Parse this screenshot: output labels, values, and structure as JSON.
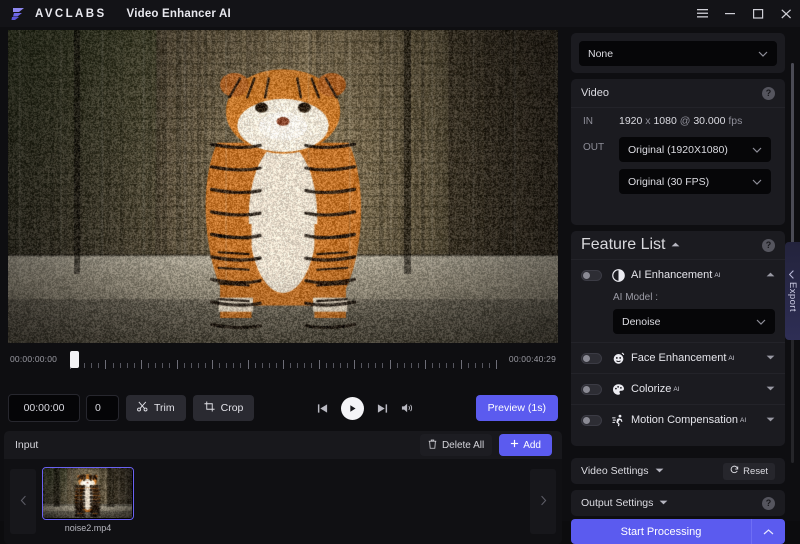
{
  "window": {
    "brand": "AVCLABS",
    "app_title": "Video Enhancer AI",
    "menu_icon": "hamburger-menu-icon",
    "minimize_icon": "minimize-icon",
    "maximize_icon": "maximize-icon",
    "close_icon": "close-icon"
  },
  "preview": {
    "timeline": {
      "start_time": "00:00:00:00",
      "end_time": "00:00:40:29",
      "playhead_icon": "playhead-handle"
    },
    "controls": {
      "current_time": "00:00:00",
      "frame_number": "0",
      "trim_label": "Trim",
      "trim_icon": "scissors-icon",
      "crop_label": "Crop",
      "crop_icon": "crop-icon",
      "prev_frame_icon": "skip-previous-icon",
      "play_icon": "play-icon",
      "next_frame_icon": "skip-next-icon",
      "volume_icon": "speaker-icon",
      "preview_label": "Preview (1s)"
    }
  },
  "input_panel": {
    "title": "Input",
    "delete_all_label": "Delete All",
    "delete_icon": "trash-icon",
    "add_label": "Add",
    "add_icon": "plus-icon",
    "prev_icon": "chevron-left-icon",
    "next_icon": "chevron-right-icon",
    "items": [
      {
        "filename": "noise2.mp4"
      }
    ]
  },
  "sidebar": {
    "preset": {
      "value": "None",
      "chevron_icon": "chevron-down-icon"
    },
    "video": {
      "title": "Video",
      "help_icon": "help-icon",
      "in_label": "IN",
      "in_value": "1920 x 1080 @ 30.000 fps",
      "in_width": "1920",
      "in_sep": "x",
      "in_height": "1080",
      "in_at": "@",
      "in_fps": "30.000",
      "in_fps_unit": "fps",
      "out_label": "OUT",
      "out_resolution": "Original (1920X1080)",
      "out_framerate": "Original (30 FPS)"
    },
    "feature_list": {
      "title": "Feature List",
      "collapse_icon": "caret-up-icon",
      "help_icon": "help-icon",
      "features": [
        {
          "label": "AI Enhancement",
          "badge": "AI",
          "icon": "contrast-icon",
          "enabled": false,
          "expanded": true,
          "chevron_icon": "caret-up-icon",
          "model_label": "AI Model :",
          "model_value": "Denoise"
        },
        {
          "label": "Face Enhancement",
          "badge": "AI",
          "icon": "face-icon",
          "enabled": false,
          "expanded": false,
          "chevron_icon": "caret-down-icon"
        },
        {
          "label": "Colorize",
          "badge": "AI",
          "icon": "palette-icon",
          "enabled": false,
          "expanded": false,
          "chevron_icon": "caret-down-icon"
        },
        {
          "label": "Motion Compensation",
          "badge": "AI",
          "icon": "running-person-icon",
          "enabled": false,
          "expanded": false,
          "chevron_icon": "caret-down-icon"
        }
      ]
    },
    "video_settings": {
      "title": "Video Settings",
      "caret_icon": "caret-down-icon",
      "reset_label": "Reset",
      "reset_icon": "refresh-icon"
    },
    "output_settings": {
      "title": "Output Settings",
      "caret_icon": "caret-down-icon",
      "help_icon": "help-icon"
    },
    "start_processing": {
      "label": "Start Processing",
      "chevron_icon": "chevron-up-icon"
    },
    "export_tab": {
      "label": "Export",
      "chevron_icon": "chevron-left-icon"
    }
  }
}
